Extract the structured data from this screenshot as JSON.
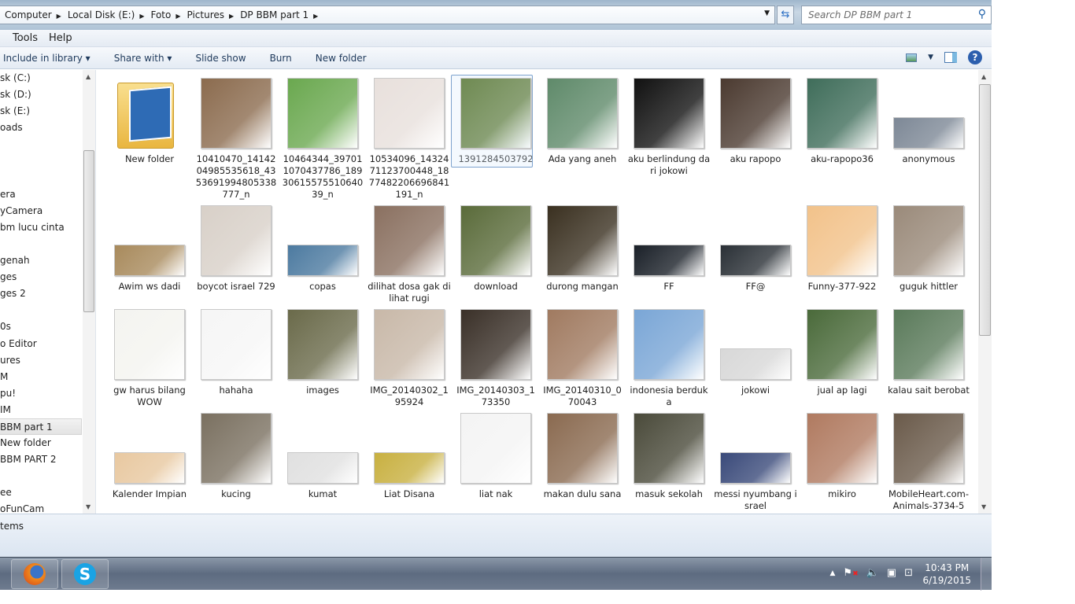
{
  "address": {
    "crumbs": [
      "Computer",
      "Local Disk (E:)",
      "Foto",
      "Pictures",
      "DP BBM part 1"
    ],
    "search_placeholder": "Search DP BBM part 1"
  },
  "menu": [
    "Tools",
    "Help"
  ],
  "toolbar": {
    "include": "Include in library ▾",
    "share": "Share with ▾",
    "slideshow": "Slide show",
    "burn": "Burn",
    "newfolder": "New folder"
  },
  "nav": [
    "sk (C:)",
    "sk (D:)",
    "sk (E:)",
    "oads",
    "",
    "",
    "",
    "era",
    "yCamera",
    "bm lucu cinta",
    "",
    "genah",
    "ges",
    "ges 2",
    "",
    "0s",
    "o Editor",
    "ures",
    "M",
    "pu!",
    "IM",
    "BBM part 1",
    "New folder",
    "BBM PART 2",
    "",
    "ee",
    "oFunCam"
  ],
  "nav_selected": 21,
  "items": [
    {
      "name": "New folder",
      "folder": true
    },
    {
      "name": "10410470_1414204985535618_4353691994805338777_n",
      "color": "#8b6b4e"
    },
    {
      "name": "10464344_397011070437786_1893061557551064039_n",
      "color": "#6aa84f"
    },
    {
      "name": "10534096_1432471123700448_1877482206696841191_n",
      "color": "#e8e0dc"
    },
    {
      "name": "1391284503792",
      "color": "#6f8a52",
      "selected": true
    },
    {
      "name": "Ada yang aneh",
      "color": "#5f8a6a"
    },
    {
      "name": "aku berlindung dari jokowi",
      "color": "#111111"
    },
    {
      "name": "aku rapopo",
      "color": "#4b3a30"
    },
    {
      "name": "aku-rapopo36",
      "color": "#3f6d5a"
    },
    {
      "name": "anonymous",
      "color": "#7d8896",
      "short": true
    },
    {
      "name": "Awim ws dadi",
      "color": "#a88a5c",
      "short": true
    },
    {
      "name": "boycot israel 729",
      "color": "#d8d0c8"
    },
    {
      "name": "copas",
      "color": "#4c7aa0",
      "short": true
    },
    {
      "name": "dilihat dosa gak dilihat rugi",
      "color": "#8a7060"
    },
    {
      "name": "download",
      "color": "#5a6b3a"
    },
    {
      "name": "durong mangan",
      "color": "#3a3020"
    },
    {
      "name": "FF",
      "color": "#1a2028",
      "short": true
    },
    {
      "name": "FF@",
      "color": "#2a3036",
      "short": true
    },
    {
      "name": "Funny-377-922",
      "color": "#f2c28a"
    },
    {
      "name": "guguk hittler",
      "color": "#9a8a7a"
    },
    {
      "name": "gw harus bilang WOW",
      "color": "#f4f4f0"
    },
    {
      "name": "hahaha",
      "color": "#f6f6f6"
    },
    {
      "name": "images",
      "color": "#6a6a4a"
    },
    {
      "name": "IMG_20140302_195924",
      "color": "#c8b8a8"
    },
    {
      "name": "IMG_20140303_173350",
      "color": "#3a3028"
    },
    {
      "name": "IMG_20140310_070043",
      "color": "#a07a60"
    },
    {
      "name": "indonesia berduka",
      "color": "#7aa6d6"
    },
    {
      "name": "jokowi",
      "color": "#d8d8d8",
      "short": true
    },
    {
      "name": "jual ap lagi",
      "color": "#4a6a3a"
    },
    {
      "name": "kalau sait berobat",
      "color": "#5a7a5a"
    },
    {
      "name": "Kalender Impian",
      "color": "#e8c8a0",
      "short": true
    },
    {
      "name": "kucing",
      "color": "#7a7060"
    },
    {
      "name": "kumat",
      "color": "#e0e0e0",
      "short": true
    },
    {
      "name": "Liat Disana",
      "color": "#c8b040",
      "short": true
    },
    {
      "name": "liat nak",
      "color": "#f4f4f4"
    },
    {
      "name": "makan dulu sana",
      "color": "#8a6a50"
    },
    {
      "name": "masuk sekolah",
      "color": "#4a4a3a"
    },
    {
      "name": "messi nyumbang israel",
      "color": "#3a4a7a",
      "short": true
    },
    {
      "name": "mikiro",
      "color": "#b07a60"
    },
    {
      "name": "MobileHeart.com-Animals-3734-5",
      "color": "#6a5a4a"
    }
  ],
  "status": {
    "text": "tems"
  },
  "taskbar": {
    "time": "10:43 PM",
    "date": "6/19/2015",
    "apps": [
      "firefox-icon",
      "skype-icon"
    ],
    "skype_glyph": "S"
  }
}
